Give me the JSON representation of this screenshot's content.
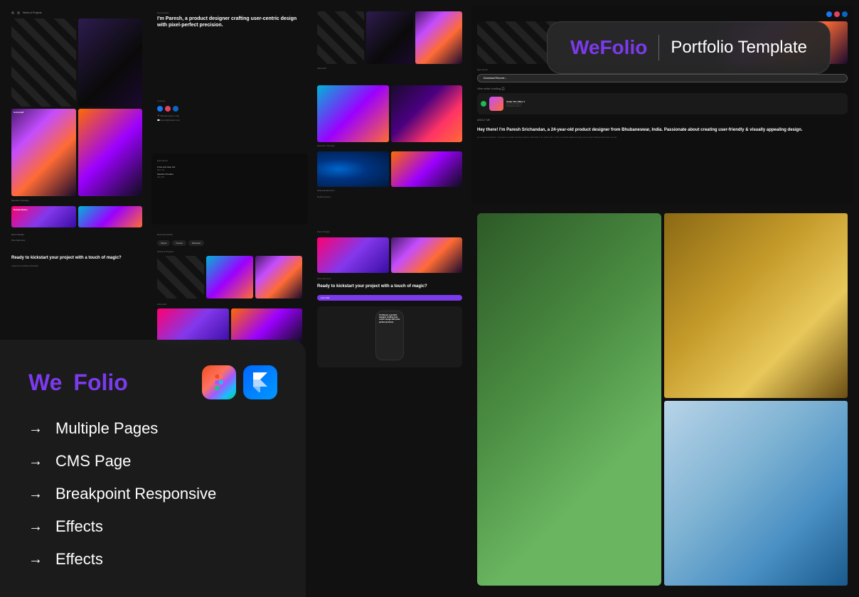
{
  "badge": {
    "logo_text": "We",
    "logo_accent": "Folio",
    "divider": "|",
    "title": "Portfolio Template"
  },
  "info_panel": {
    "logo_we": "We",
    "logo_folio": "Folio",
    "features": [
      {
        "arrow": "→",
        "label": "Multiple Pages"
      },
      {
        "arrow": "→",
        "label": "CMS Page"
      },
      {
        "arrow": "→",
        "label": "Breakpoint Responsive"
      },
      {
        "arrow": "→",
        "label": "Effects"
      },
      {
        "arrow": "→",
        "label": "Effects"
      }
    ]
  },
  "portfolio": {
    "hero_text": "I'm Paresh, a product designer crafting user-centric design with pixel-perfect precision.",
    "about_heading": "Hey there! I'm Paresh Srichandan, a 24-year-old product designer from Bhubaneswar, India. Passionate about creating user-friendly & visually appealing design.",
    "cta_label": "Let's Talk",
    "download_resume": "Download Resume",
    "vibe_label": "Vibe while hustling 🎧",
    "ready_text": "Ready to kickstart your project with a touch of magic?"
  },
  "apps": {
    "figma_label": "Figma",
    "framer_label": "Framer"
  }
}
